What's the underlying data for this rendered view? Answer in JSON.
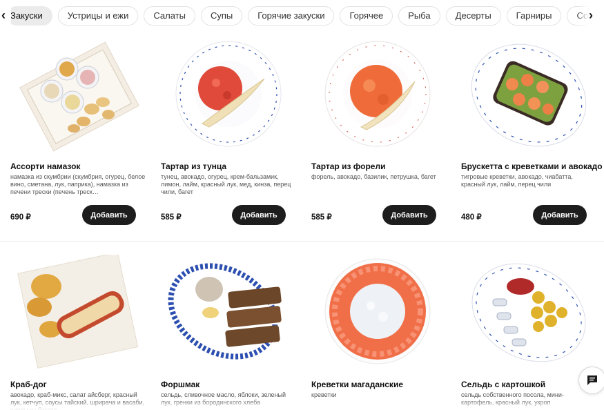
{
  "category_tabs": [
    {
      "label": "Закуски",
      "active": true
    },
    {
      "label": "Устрицы и ежи",
      "active": false
    },
    {
      "label": "Салаты",
      "active": false
    },
    {
      "label": "Супы",
      "active": false
    },
    {
      "label": "Горячие закуски",
      "active": false
    },
    {
      "label": "Горячее",
      "active": false
    },
    {
      "label": "Рыба",
      "active": false
    },
    {
      "label": "Десерты",
      "active": false
    },
    {
      "label": "Гарниры",
      "active": false
    },
    {
      "label": "Соусы",
      "active": false
    }
  ],
  "products": [
    {
      "name": "Ассорти намазок",
      "description": "намазка из скумбрии (скумбрия, огурец, белое вино, сметана, лук, паприка), намазка из печени трески (печень треск…",
      "price": "690 ₽",
      "add_label": "Добавить",
      "image": "spreads-assortment-photo"
    },
    {
      "name": "Тартар из тунца",
      "description": "тунец, авокадо, огурец, крем-бальзамик, лимон, лайм, красный лук, мед, кинза, перец чили, багет",
      "price": "585 ₽",
      "add_label": "Добавить",
      "image": "tuna-tartare-photo"
    },
    {
      "name": "Тартар из форели",
      "description": "форель, авокадо, базилик, петрушка, багет",
      "price": "585 ₽",
      "add_label": "Добавить",
      "image": "trout-tartare-photo"
    },
    {
      "name": "Брускетта с креветками и авокадо",
      "description": "тигровые креветки, авокадо, чиабатта, красный лук, лайм, перец чили",
      "price": "480 ₽",
      "add_label": "Добавить",
      "image": "shrimp-bruschetta-photo"
    },
    {
      "name": "Краб-дог",
      "description": "авокадо, краб-микс, салат айсберг, красный лук, кетчуп, соусы тайский, шрирача и васаби, чипсы из батата",
      "price": "",
      "add_label": "",
      "image": "crab-dog-photo"
    },
    {
      "name": "Форшмак",
      "description": "сельдь, сливочное масло, яблоки, зеленый лук, гренки из бородинского хлеба",
      "price": "",
      "add_label": "",
      "image": "forshmak-photo"
    },
    {
      "name": "Креветки магаданские",
      "description": "креветки",
      "price": "",
      "add_label": "",
      "image": "magadan-shrimp-photo"
    },
    {
      "name": "Сельдь с картошкой",
      "description": "сельдь собственного посола, мини-картофель, красный лук, укроп",
      "price": "",
      "add_label": "",
      "image": "herring-potatoes-photo"
    }
  ],
  "colors": {
    "button_bg": "#1d1d1d",
    "tab_active_bg": "#ebebeb",
    "tab_border": "#e2e2e2"
  },
  "icons": {
    "prev": "chevron-left-icon",
    "next": "chevron-right-icon",
    "chat": "chat-bubble-icon"
  }
}
